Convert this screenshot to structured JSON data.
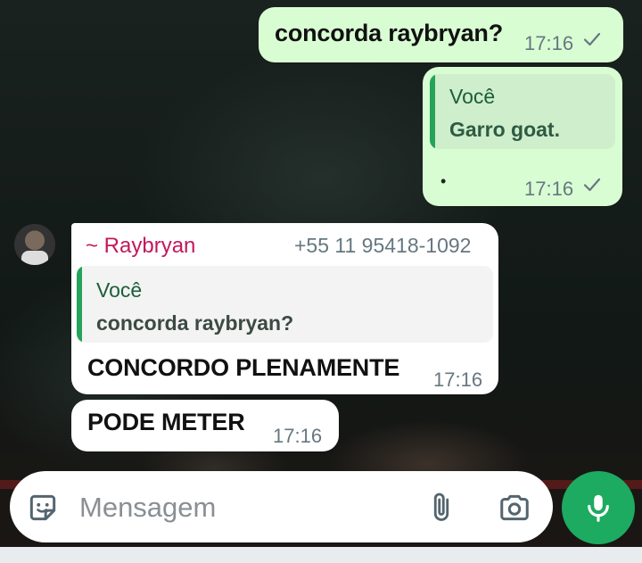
{
  "messages": {
    "m1": {
      "text": "concorda raybryan?",
      "time": "17:16"
    },
    "m2": {
      "quote_author": "Você",
      "quote_text": "Garro goat.",
      "text": "•",
      "time": "17:16"
    },
    "m3": {
      "sender": "~ Raybryan",
      "phone": "+55 11 95418-1092",
      "quote_author": "Você",
      "quote_text": "concorda raybryan?",
      "text": "CONCORDO PLENAMENTE",
      "time": "17:16"
    },
    "m4": {
      "text": "PODE METER",
      "time": "17:16"
    }
  },
  "composer": {
    "placeholder": "Mensagem"
  },
  "colors": {
    "outgoing_bubble": "#d9fdd3",
    "incoming_bubble": "#ffffff",
    "sender_name": "#c2185b",
    "quote_bar": "#25a35a",
    "mic_button": "#1daa61"
  },
  "icons": {
    "read_tick": "check-icon",
    "sticker": "sticker-icon",
    "attach": "paperclip-icon",
    "camera": "camera-icon",
    "mic": "microphone-icon"
  }
}
